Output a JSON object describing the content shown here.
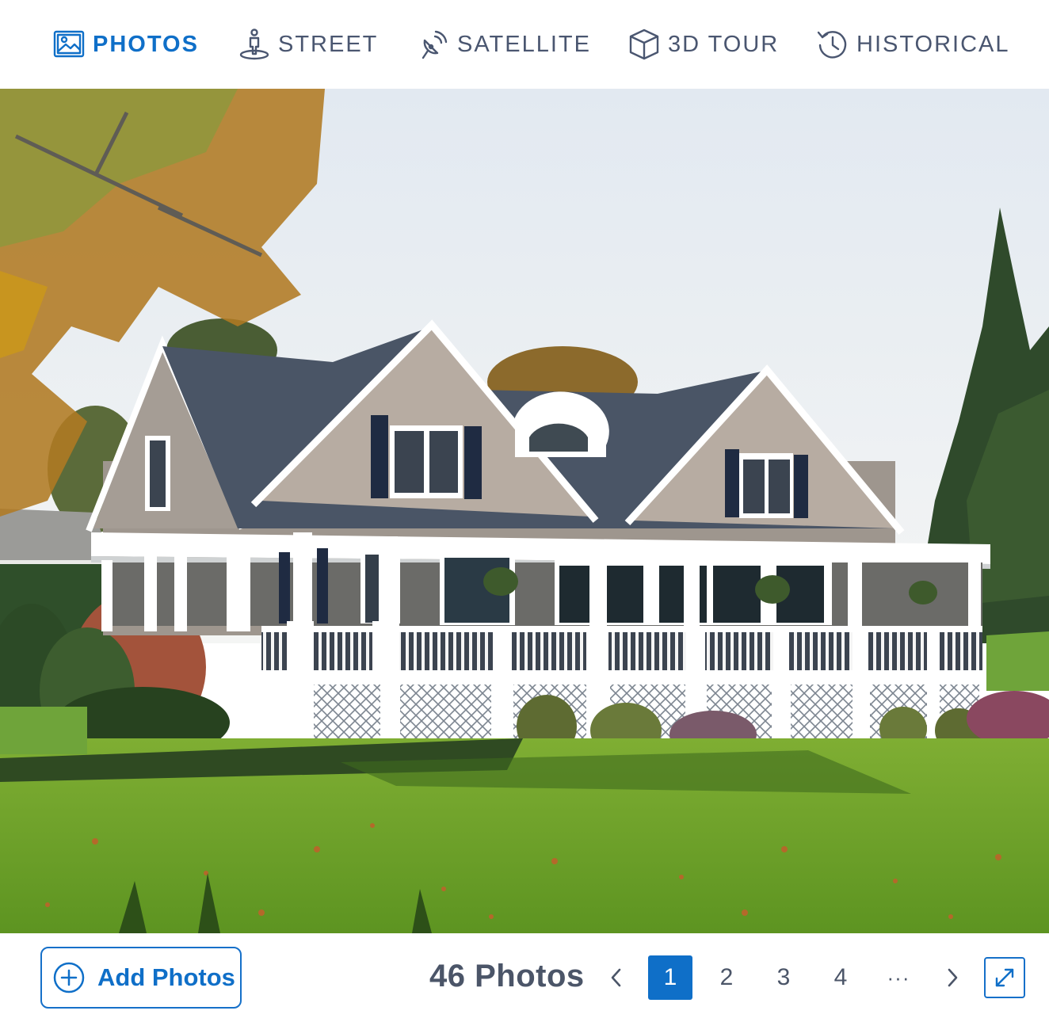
{
  "tabs": [
    {
      "label": "PHOTOS",
      "icon": "image-icon",
      "active": true
    },
    {
      "label": "STREET",
      "icon": "street-view-icon",
      "active": false
    },
    {
      "label": "SATELLITE",
      "icon": "satellite-icon",
      "active": false
    },
    {
      "label": "3D TOUR",
      "icon": "cube-icon",
      "active": false
    },
    {
      "label": "HISTORICAL",
      "icon": "history-icon",
      "active": false
    }
  ],
  "photo": {
    "alt": "photo-of-house"
  },
  "footer": {
    "add_photos_label": "Add Photos",
    "photo_count": "46 Photos",
    "pages": [
      "1",
      "2",
      "3",
      "4"
    ],
    "ellipsis": "···",
    "current_page": "1"
  },
  "colors": {
    "accent": "#0f6fc8",
    "text": "#4b5568"
  }
}
